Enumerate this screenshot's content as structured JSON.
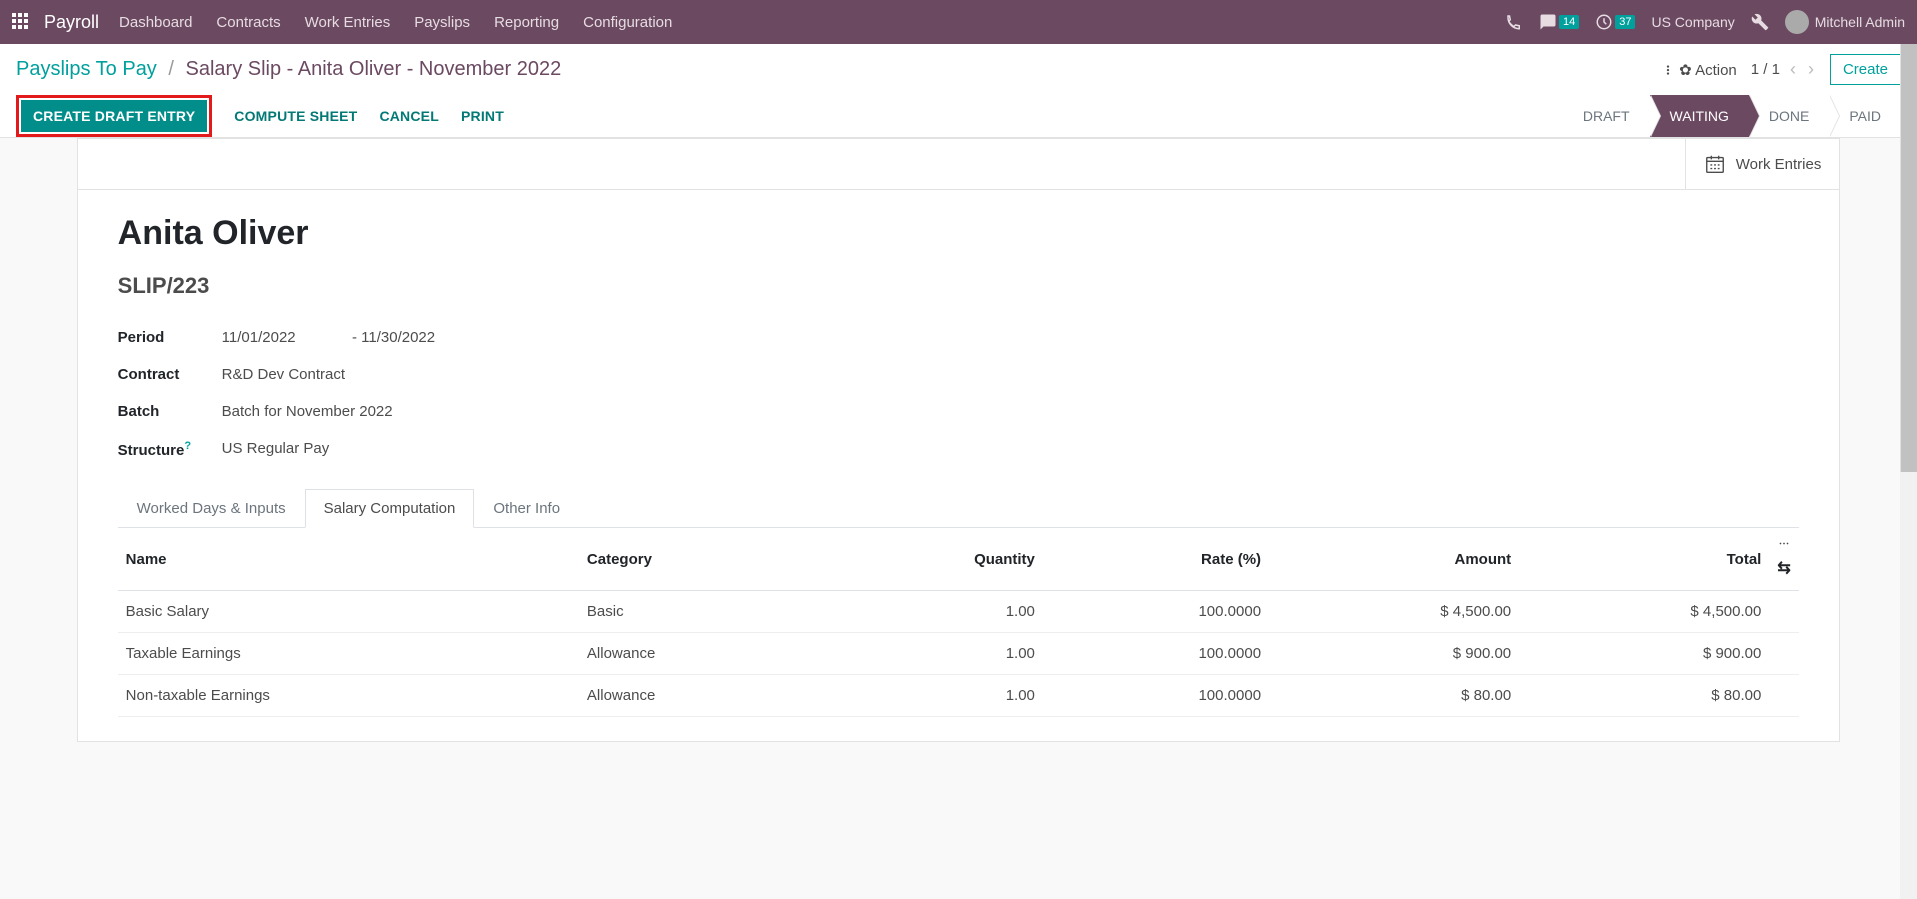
{
  "navbar": {
    "app_name": "Payroll",
    "menu": [
      "Dashboard",
      "Contracts",
      "Work Entries",
      "Payslips",
      "Reporting",
      "Configuration"
    ],
    "messages_count": "14",
    "activities_count": "37",
    "company": "US Company",
    "user": "Mitchell Admin"
  },
  "breadcrumb": {
    "parent": "Payslips To Pay",
    "current": "Salary Slip - Anita Oliver - November 2022"
  },
  "action_label": "Action",
  "pager": "1 / 1",
  "create_label": "Create",
  "buttons": {
    "create_draft": "CREATE DRAFT ENTRY",
    "compute": "COMPUTE SHEET",
    "cancel": "CANCEL",
    "print": "PRINT"
  },
  "status": {
    "draft": "DRAFT",
    "waiting": "WAITING",
    "done": "DONE",
    "paid": "PAID"
  },
  "smart_button": "Work Entries",
  "record": {
    "employee": "Anita Oliver",
    "number": "SLIP/223",
    "period_label": "Period",
    "period_from": "11/01/2022",
    "period_sep": "-",
    "period_to": "11/30/2022",
    "contract_label": "Contract",
    "contract": "R&D Dev Contract",
    "batch_label": "Batch",
    "batch": "Batch for November 2022",
    "structure_label": "Structure",
    "structure": "US Regular Pay"
  },
  "tabs": {
    "worked_days": "Worked Days & Inputs",
    "salary_comp": "Salary Computation",
    "other_info": "Other Info"
  },
  "table": {
    "headers": {
      "name": "Name",
      "category": "Category",
      "quantity": "Quantity",
      "rate": "Rate (%)",
      "amount": "Amount",
      "total": "Total"
    },
    "rows": [
      {
        "name": "Basic Salary",
        "category": "Basic",
        "quantity": "1.00",
        "rate": "100.0000",
        "amount": "$ 4,500.00",
        "total": "$ 4,500.00"
      },
      {
        "name": "Taxable Earnings",
        "category": "Allowance",
        "quantity": "1.00",
        "rate": "100.0000",
        "amount": "$ 900.00",
        "total": "$ 900.00"
      },
      {
        "name": "Non-taxable Earnings",
        "category": "Allowance",
        "quantity": "1.00",
        "rate": "100.0000",
        "amount": "$ 80.00",
        "total": "$ 80.00"
      }
    ]
  }
}
